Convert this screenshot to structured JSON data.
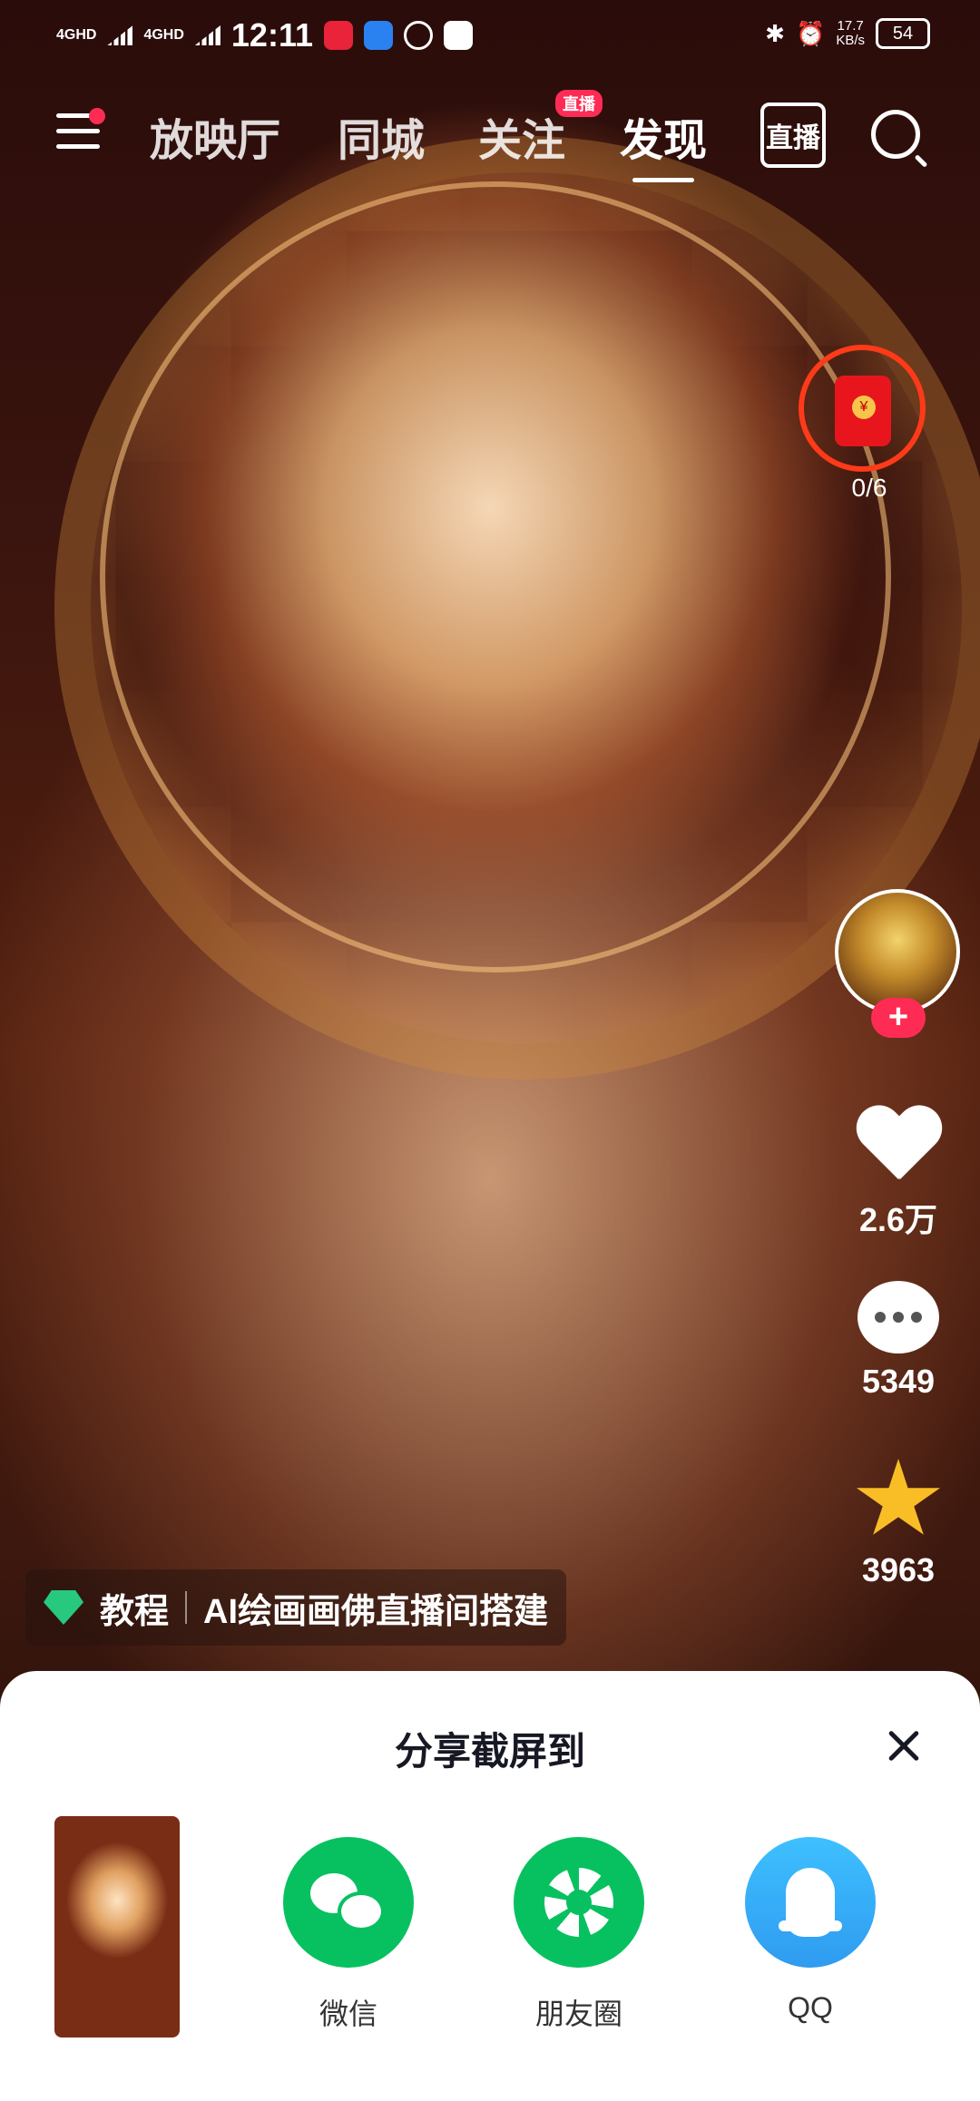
{
  "status_bar": {
    "network1": "4GHD",
    "network2": "4GHD",
    "time": "12:11",
    "speed_value": "17.7",
    "speed_unit": "KB/s",
    "battery": "54"
  },
  "top_nav": {
    "tabs": [
      "放映厅",
      "同城",
      "关注",
      "发现"
    ],
    "active_tab": "发现",
    "follow_badge": "直播",
    "live_label": "直播"
  },
  "red_packet": {
    "count": "0/6"
  },
  "right_rail": {
    "like_count": "2.6万",
    "comment_count": "5349",
    "favorite_count": "3963"
  },
  "tutorial_tag": {
    "label": "教程",
    "text": "AI绘画画佛直播间搭建"
  },
  "share_sheet": {
    "title": "分享截屏到",
    "options": [
      {
        "label": "微信",
        "color": "#07c160",
        "icon": "wechat-icon"
      },
      {
        "label": "朋友圈",
        "color": "#07c160",
        "icon": "moments-icon"
      },
      {
        "label": "QQ",
        "color": "#3eb4ff",
        "icon": "qq-icon"
      }
    ]
  }
}
